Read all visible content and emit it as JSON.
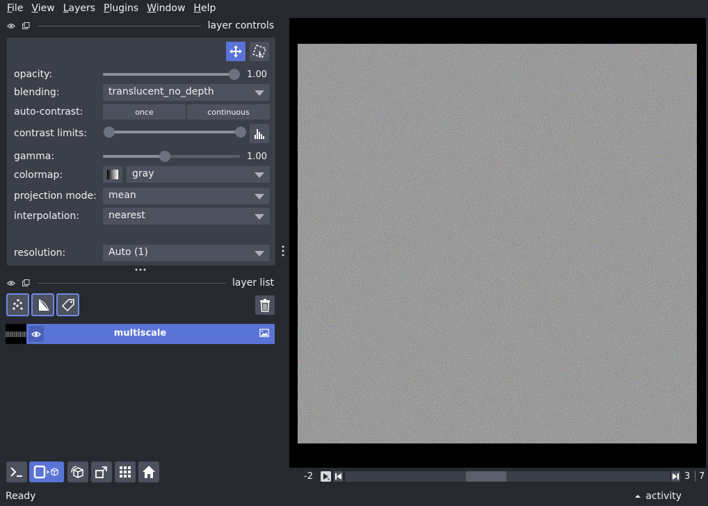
{
  "menu": [
    {
      "label": "File",
      "key": "F",
      "rest": "ile"
    },
    {
      "label": "View",
      "key": "V",
      "rest": "iew"
    },
    {
      "label": "Layers",
      "key": "L",
      "rest": "ayers"
    },
    {
      "label": "Plugins",
      "key": "P",
      "rest": "lugins"
    },
    {
      "label": "Window",
      "key": "W",
      "rest": "indow"
    },
    {
      "label": "Help",
      "key": "H",
      "rest": "elp"
    }
  ],
  "layer_controls": {
    "title": "layer controls",
    "opacity": {
      "label": "opacity:",
      "value": "1.00",
      "fraction": 1.0
    },
    "blending": {
      "label": "blending:",
      "value": "translucent_no_depth"
    },
    "auto_contrast": {
      "label": "auto-contrast:",
      "once": "once",
      "continuous": "continuous"
    },
    "contrast_limits": {
      "label": "contrast limits:",
      "low_fraction": 0.0,
      "high_fraction": 1.0
    },
    "gamma": {
      "label": "gamma:",
      "value": "1.00",
      "fraction": 0.45
    },
    "colormap": {
      "label": "colormap:",
      "value": "gray"
    },
    "projection_mode": {
      "label": "projection mode:",
      "value": "mean"
    },
    "interpolation": {
      "label": "interpolation:",
      "value": "nearest"
    },
    "resolution": {
      "label": "resolution:",
      "value": "Auto (1)"
    }
  },
  "layer_list": {
    "title": "layer list",
    "layers": [
      {
        "name": "multiscale",
        "visible": true,
        "type_icon": "image-icon"
      }
    ]
  },
  "dims": {
    "left_label": "-2",
    "current": "3",
    "max": "7",
    "slider_fraction": 0.4
  },
  "status": {
    "text": "Ready",
    "activity": "activity"
  },
  "colors": {
    "accent": "#5a73d6",
    "panel": "#3b3f49",
    "background": "#262930"
  }
}
